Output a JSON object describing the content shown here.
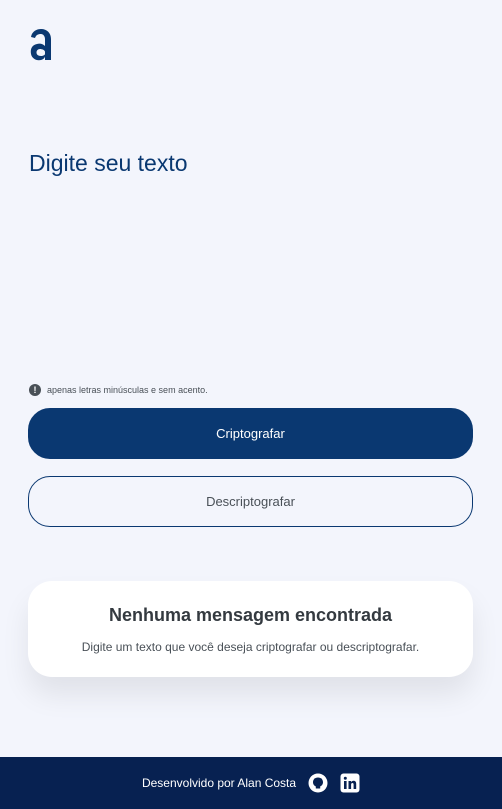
{
  "app": {
    "logo_icon": "alura-logo-icon"
  },
  "input": {
    "placeholder": "Digite seu texto",
    "value": ""
  },
  "hint": {
    "icon": "exclamation-circle-icon",
    "text": "apenas letras minúsculas e sem acento."
  },
  "buttons": {
    "encrypt_label": "Criptografar",
    "decrypt_label": "Descriptografar"
  },
  "result": {
    "title": "Nenhuma mensagem encontrada",
    "text": "Digite um texto que você deseja criptografar ou descriptografar."
  },
  "footer": {
    "text": "Desenvolvido por Alan Costa",
    "icons": [
      "github-icon",
      "linkedin-icon"
    ]
  },
  "colors": {
    "background": "#f3f5fc",
    "primary": "#0a3871",
    "footer": "#072151",
    "card": "#ffffff"
  }
}
